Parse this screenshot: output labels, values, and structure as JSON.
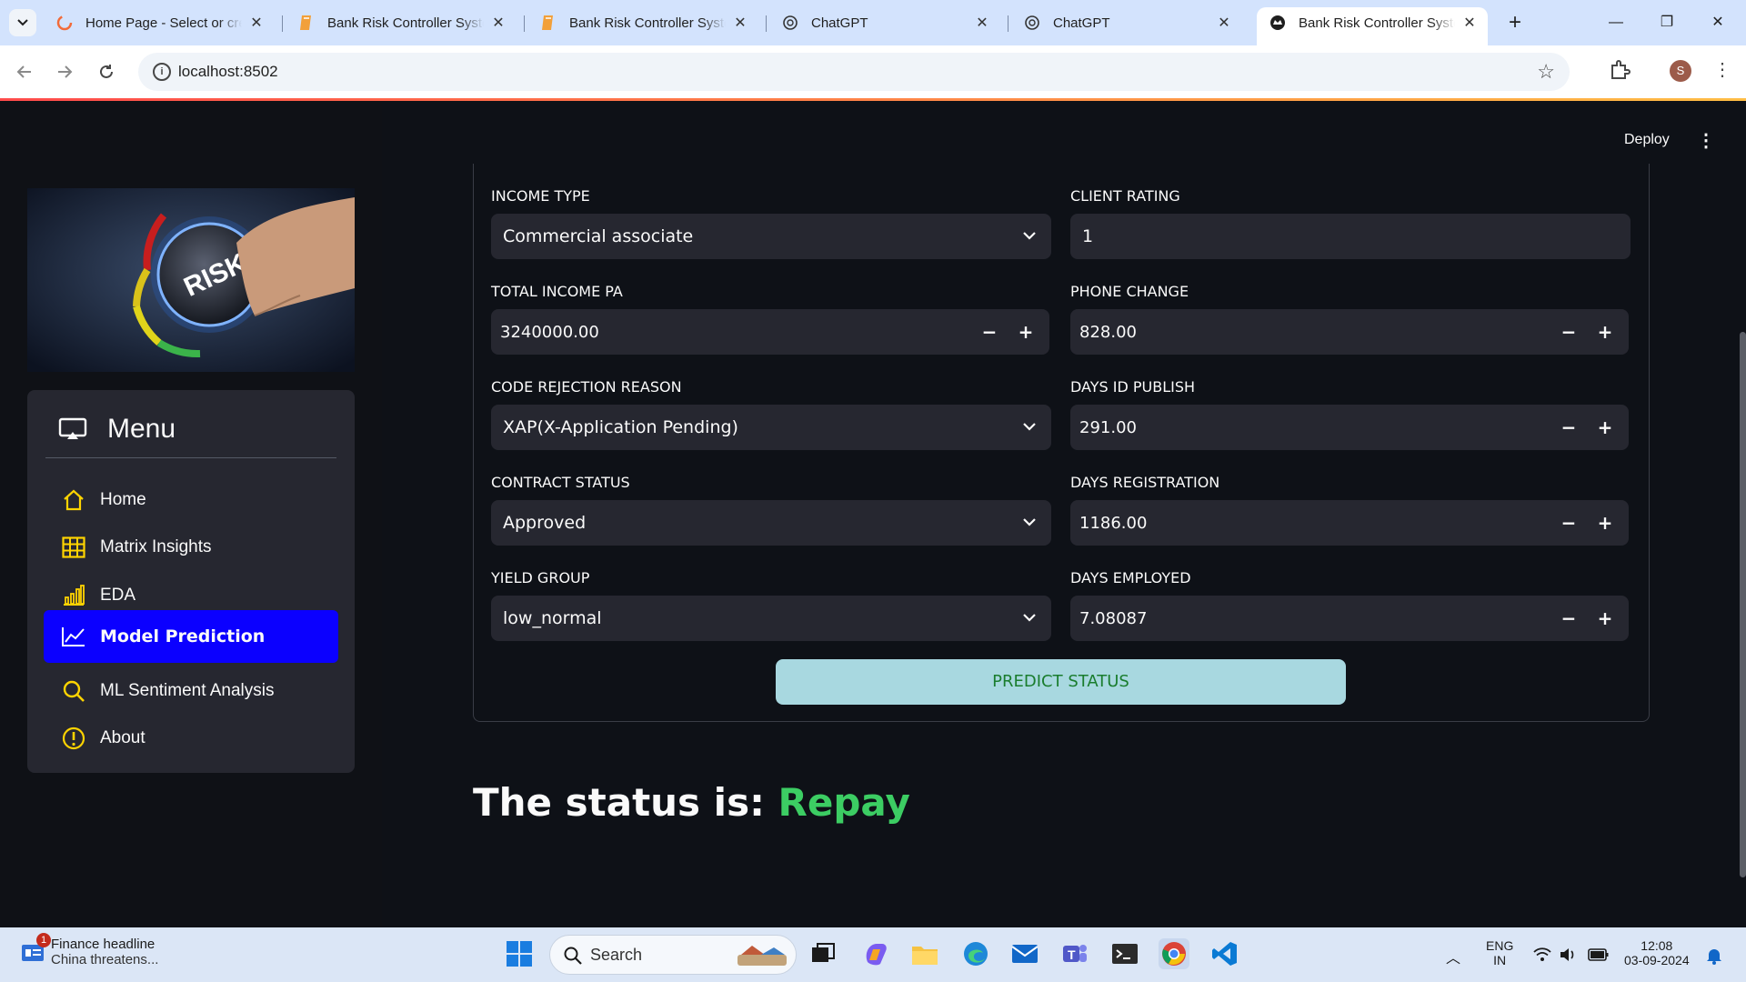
{
  "browser": {
    "tabs": [
      {
        "title": "Home Page - Select or create",
        "icon": "loading-ring-icon",
        "active": false
      },
      {
        "title": "Bank Risk Controller System",
        "icon": "streamlit-bookmark-icon",
        "active": false
      },
      {
        "title": "Bank Risk Controller System",
        "icon": "streamlit-bookmark-icon",
        "active": false
      },
      {
        "title": "ChatGPT",
        "icon": "chatgpt-icon",
        "active": false
      },
      {
        "title": "ChatGPT",
        "icon": "chatgpt-icon",
        "active": false
      },
      {
        "title": "Bank Risk Controller System",
        "icon": "streamlit-crown-icon",
        "active": true
      }
    ],
    "url": "localhost:8502",
    "profile_initial": "S"
  },
  "app": {
    "deploy_label": "Deploy",
    "menu": {
      "title": "Menu",
      "items": [
        {
          "label": "Home",
          "icon": "home-icon"
        },
        {
          "label": "Matrix Insights",
          "icon": "table-icon"
        },
        {
          "label": "EDA",
          "icon": "bar-chart-icon"
        },
        {
          "label": "Model Prediction",
          "icon": "line-chart-icon",
          "active": true
        },
        {
          "label": "ML Sentiment Analysis",
          "icon": "search-icon"
        },
        {
          "label": "About",
          "icon": "info-icon"
        }
      ]
    },
    "form": {
      "income_type": {
        "label": "INCOME TYPE",
        "value": "Commercial associate"
      },
      "client_rating": {
        "label": "CLIENT RATING",
        "value": "1"
      },
      "total_income": {
        "label": "TOTAL INCOME PA",
        "value": "3240000.00"
      },
      "phone_change": {
        "label": "PHONE CHANGE",
        "value": "828.00"
      },
      "code_rejection": {
        "label": "CODE REJECTION REASON",
        "value": "XAP(X-Application Pending)"
      },
      "days_id_publish": {
        "label": "DAYS ID PUBLISH",
        "value": "291.00"
      },
      "contract_status": {
        "label": "CONTRACT STATUS",
        "value": "Approved"
      },
      "days_registration": {
        "label": "DAYS REGISTRATION",
        "value": "1186.00"
      },
      "yield_group": {
        "label": "YIELD GROUP",
        "value": "low_normal"
      },
      "days_employed": {
        "label": "DAYS EMPLOYED",
        "value": "7.08087"
      },
      "predict_label": "PREDICT STATUS"
    },
    "result": {
      "prefix": "The status is:",
      "status": "Repay",
      "status_color": "#3ccd63"
    },
    "accent_color": "#0b00ff"
  },
  "taskbar": {
    "news_title": "Finance headline",
    "news_sub": "China threatens...",
    "news_badge": "1",
    "search_label": "Search",
    "lang_1": "ENG",
    "lang_2": "IN",
    "time": "12:08",
    "date": "03-09-2024"
  }
}
